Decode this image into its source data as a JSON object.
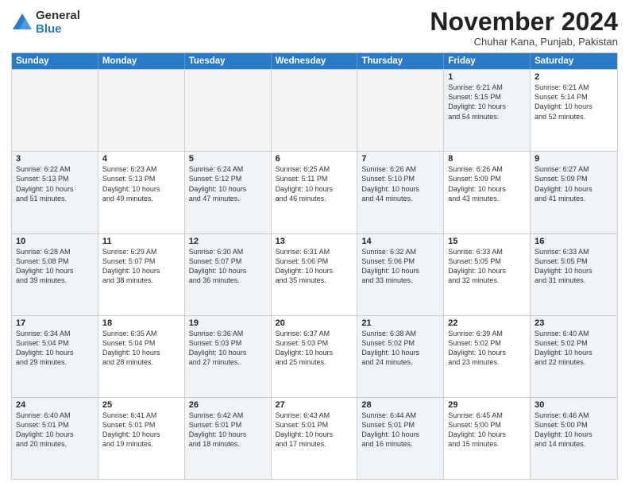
{
  "logo": {
    "general": "General",
    "blue": "Blue"
  },
  "title": "November 2024",
  "location": "Chuhar Kana, Punjab, Pakistan",
  "headers": [
    "Sunday",
    "Monday",
    "Tuesday",
    "Wednesday",
    "Thursday",
    "Friday",
    "Saturday"
  ],
  "weeks": [
    [
      {
        "day": "",
        "info": "",
        "empty": true
      },
      {
        "day": "",
        "info": "",
        "empty": true
      },
      {
        "day": "",
        "info": "",
        "empty": true
      },
      {
        "day": "",
        "info": "",
        "empty": true
      },
      {
        "day": "",
        "info": "",
        "empty": true
      },
      {
        "day": "1",
        "info": "Sunrise: 6:21 AM\nSunset: 5:15 PM\nDaylight: 10 hours\nand 54 minutes.",
        "shade": true
      },
      {
        "day": "2",
        "info": "Sunrise: 6:21 AM\nSunset: 5:14 PM\nDaylight: 10 hours\nand 52 minutes.",
        "shade": false
      }
    ],
    [
      {
        "day": "3",
        "info": "Sunrise: 6:22 AM\nSunset: 5:13 PM\nDaylight: 10 hours\nand 51 minutes.",
        "shade": true
      },
      {
        "day": "4",
        "info": "Sunrise: 6:23 AM\nSunset: 5:13 PM\nDaylight: 10 hours\nand 49 minutes.",
        "shade": false
      },
      {
        "day": "5",
        "info": "Sunrise: 6:24 AM\nSunset: 5:12 PM\nDaylight: 10 hours\nand 47 minutes.",
        "shade": true
      },
      {
        "day": "6",
        "info": "Sunrise: 6:25 AM\nSunset: 5:11 PM\nDaylight: 10 hours\nand 46 minutes.",
        "shade": false
      },
      {
        "day": "7",
        "info": "Sunrise: 6:26 AM\nSunset: 5:10 PM\nDaylight: 10 hours\nand 44 minutes.",
        "shade": true
      },
      {
        "day": "8",
        "info": "Sunrise: 6:26 AM\nSunset: 5:09 PM\nDaylight: 10 hours\nand 43 minutes.",
        "shade": false
      },
      {
        "day": "9",
        "info": "Sunrise: 6:27 AM\nSunset: 5:09 PM\nDaylight: 10 hours\nand 41 minutes.",
        "shade": true
      }
    ],
    [
      {
        "day": "10",
        "info": "Sunrise: 6:28 AM\nSunset: 5:08 PM\nDaylight: 10 hours\nand 39 minutes.",
        "shade": true
      },
      {
        "day": "11",
        "info": "Sunrise: 6:29 AM\nSunset: 5:07 PM\nDaylight: 10 hours\nand 38 minutes.",
        "shade": false
      },
      {
        "day": "12",
        "info": "Sunrise: 6:30 AM\nSunset: 5:07 PM\nDaylight: 10 hours\nand 36 minutes.",
        "shade": true
      },
      {
        "day": "13",
        "info": "Sunrise: 6:31 AM\nSunset: 5:06 PM\nDaylight: 10 hours\nand 35 minutes.",
        "shade": false
      },
      {
        "day": "14",
        "info": "Sunrise: 6:32 AM\nSunset: 5:06 PM\nDaylight: 10 hours\nand 33 minutes.",
        "shade": true
      },
      {
        "day": "15",
        "info": "Sunrise: 6:33 AM\nSunset: 5:05 PM\nDaylight: 10 hours\nand 32 minutes.",
        "shade": false
      },
      {
        "day": "16",
        "info": "Sunrise: 6:33 AM\nSunset: 5:05 PM\nDaylight: 10 hours\nand 31 minutes.",
        "shade": true
      }
    ],
    [
      {
        "day": "17",
        "info": "Sunrise: 6:34 AM\nSunset: 5:04 PM\nDaylight: 10 hours\nand 29 minutes.",
        "shade": true
      },
      {
        "day": "18",
        "info": "Sunrise: 6:35 AM\nSunset: 5:04 PM\nDaylight: 10 hours\nand 28 minutes.",
        "shade": false
      },
      {
        "day": "19",
        "info": "Sunrise: 6:36 AM\nSunset: 5:03 PM\nDaylight: 10 hours\nand 27 minutes.",
        "shade": true
      },
      {
        "day": "20",
        "info": "Sunrise: 6:37 AM\nSunset: 5:03 PM\nDaylight: 10 hours\nand 25 minutes.",
        "shade": false
      },
      {
        "day": "21",
        "info": "Sunrise: 6:38 AM\nSunset: 5:02 PM\nDaylight: 10 hours\nand 24 minutes.",
        "shade": true
      },
      {
        "day": "22",
        "info": "Sunrise: 6:39 AM\nSunset: 5:02 PM\nDaylight: 10 hours\nand 23 minutes.",
        "shade": false
      },
      {
        "day": "23",
        "info": "Sunrise: 6:40 AM\nSunset: 5:02 PM\nDaylight: 10 hours\nand 22 minutes.",
        "shade": true
      }
    ],
    [
      {
        "day": "24",
        "info": "Sunrise: 6:40 AM\nSunset: 5:01 PM\nDaylight: 10 hours\nand 20 minutes.",
        "shade": true
      },
      {
        "day": "25",
        "info": "Sunrise: 6:41 AM\nSunset: 5:01 PM\nDaylight: 10 hours\nand 19 minutes.",
        "shade": false
      },
      {
        "day": "26",
        "info": "Sunrise: 6:42 AM\nSunset: 5:01 PM\nDaylight: 10 hours\nand 18 minutes.",
        "shade": true
      },
      {
        "day": "27",
        "info": "Sunrise: 6:43 AM\nSunset: 5:01 PM\nDaylight: 10 hours\nand 17 minutes.",
        "shade": false
      },
      {
        "day": "28",
        "info": "Sunrise: 6:44 AM\nSunset: 5:01 PM\nDaylight: 10 hours\nand 16 minutes.",
        "shade": true
      },
      {
        "day": "29",
        "info": "Sunrise: 6:45 AM\nSunset: 5:00 PM\nDaylight: 10 hours\nand 15 minutes.",
        "shade": false
      },
      {
        "day": "30",
        "info": "Sunrise: 6:46 AM\nSunset: 5:00 PM\nDaylight: 10 hours\nand 14 minutes.",
        "shade": true
      }
    ]
  ]
}
